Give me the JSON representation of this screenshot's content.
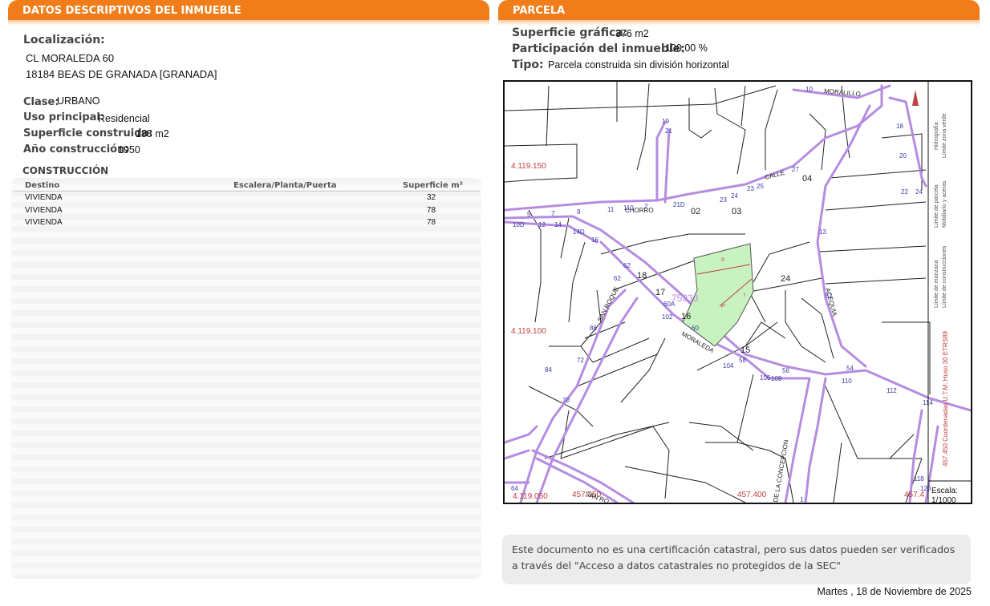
{
  "left": {
    "header": "DATOS DESCRIPTIVOS DEL INMUEBLE",
    "localizacion_label": "Localización:",
    "address_line1": "CL MORALEDA 60",
    "address_line2": "18184 BEAS DE GRANADA [GRANADA]",
    "clase_label": "Clase:",
    "clase_value": "URBANO",
    "uso_label": "Uso principal:",
    "uso_value": "Residencial",
    "superficie_label": "Superficie construida:",
    "superficie_value": "188 m2",
    "anio_label": "Año construcción:",
    "anio_value": "1950",
    "construccion_title": "CONSTRUCCIÓN",
    "table": {
      "headers": [
        "Destino",
        "Escalera/Planta/Puerta",
        "Superficie m²"
      ],
      "rows": [
        {
          "destino": "VIVIENDA",
          "epp": "",
          "superficie": "32"
        },
        {
          "destino": "VIVIENDA",
          "epp": "",
          "superficie": "78"
        },
        {
          "destino": "VIVIENDA",
          "epp": "",
          "superficie": "78"
        }
      ]
    }
  },
  "right": {
    "header": "PARCELA",
    "superficie_grafica_label": "Superficie gráfica:",
    "superficie_grafica_value": "376 m2",
    "participacion_label": "Participación del inmueble:",
    "participacion_value": "100,00 %",
    "tipo_label": "Tipo:",
    "tipo_value": "Parcela construida sin división horizontal",
    "map": {
      "coords": [
        "4.119.150",
        "4.119.100",
        "4.119.050",
        "457.350",
        "457.400",
        "457.4"
      ],
      "parcel_ref": "75933",
      "parcel_numbers": [
        "02",
        "03",
        "04",
        "24",
        "18",
        "17",
        "16",
        "15"
      ],
      "parcel_subunits": [
        "II",
        "I",
        "P"
      ],
      "streets": [
        "MORALILLO",
        "CALLE",
        "CHORRO",
        "SAN ROQUE",
        "MORALEDA",
        "ACEQUIA",
        "DE LA CONCEPCION",
        "SAN RO"
      ],
      "address_numbers": [
        "10",
        "18",
        "20",
        "22",
        "24",
        "21",
        "19",
        "5",
        "7",
        "9",
        "11",
        "110",
        "2",
        "21D",
        "23",
        "24",
        "23",
        "25",
        "27",
        "10D",
        "12",
        "14",
        "14D",
        "16",
        "62",
        "62",
        "60A",
        "60",
        "102",
        "86",
        "84",
        "72",
        "70",
        "104",
        "58",
        "106",
        "56",
        "108",
        "110",
        "112",
        "114",
        "54",
        "13",
        "51",
        "64",
        "118",
        "120",
        "1"
      ],
      "legend": [
        "Hidrografía",
        "Límite zona verde",
        "Límite de parcela",
        "Mobiliario y aceras",
        "Límite de manzana",
        "Límite de construcciones"
      ],
      "coord_note": "457.450 Coordenadas U.T.M. Huso 30 ETRS89",
      "scale_label": "Escala:",
      "scale_value": "1/1000",
      "colors": {
        "parcel": "#c8f2c0",
        "street": "#b68ce0",
        "coord_text": "#c04040"
      }
    },
    "notice": "Este documento no es una certificación catastral, pero sus datos pueden ser verificados a través del \"Acceso a datos catastrales no protegidos de la SEC\"",
    "date": "Martes , 18 de Noviembre de 2025"
  }
}
